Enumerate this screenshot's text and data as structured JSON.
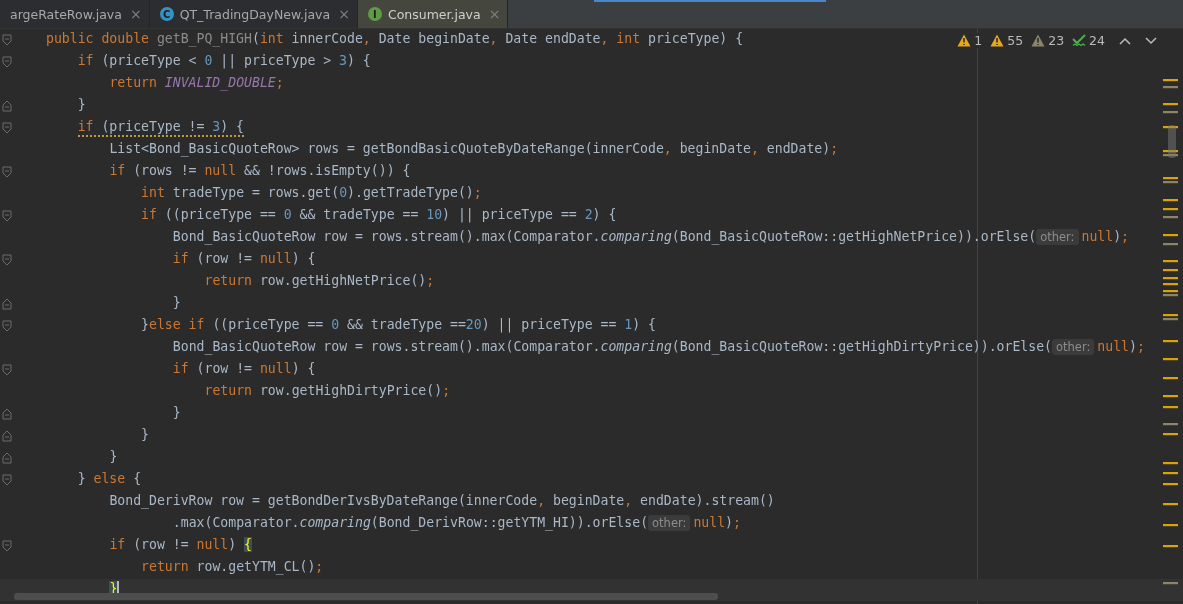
{
  "tabs": [
    {
      "label": "argeRateRow.java",
      "close": "×",
      "selected": false
    },
    {
      "label": "QT_TradingDayNew.java",
      "badge": {
        "letter": "C",
        "color": "#3592c4"
      },
      "close": "×",
      "selected": false
    },
    {
      "label": "Consumer.java",
      "badge": {
        "letter": "I",
        "color": "#5f9b45"
      },
      "close": "×",
      "selected": true
    }
  ],
  "inspections": [
    {
      "kind": "warning",
      "count": "1"
    },
    {
      "kind": "warning",
      "count": "55"
    },
    {
      "kind": "weak",
      "count": "23"
    },
    {
      "kind": "typo",
      "count": "24"
    }
  ],
  "lines": [
    {
      "kind": "open",
      "warning": false,
      "current": false,
      "tokens": [
        {
          "text": "public double ",
          "kind": "keyword"
        },
        {
          "text": "getB_PQ_HIGH",
          "kind": "unused"
        },
        {
          "text": "(",
          "kind": "plain"
        },
        {
          "text": "int ",
          "kind": "keyword"
        },
        {
          "text": "innerCode",
          "kind": "plain"
        },
        {
          "text": ", ",
          "kind": "punct"
        },
        {
          "text": "Date beginDate",
          "kind": "plain"
        },
        {
          "text": ", ",
          "kind": "punct"
        },
        {
          "text": "Date endDate",
          "kind": "plain"
        },
        {
          "text": ", ",
          "kind": "punct"
        },
        {
          "text": "int ",
          "kind": "keyword"
        },
        {
          "text": "priceType) {",
          "kind": "plain"
        }
      ],
      "children": [
        {
          "kind": "open",
          "warning": false,
          "current": false,
          "tokens": [
            {
              "text": "if ",
              "kind": "keyword"
            },
            {
              "text": "(priceType < ",
              "kind": "plain"
            },
            {
              "text": "0",
              "kind": "number"
            },
            {
              "text": " || priceType > ",
              "kind": "plain"
            },
            {
              "text": "3",
              "kind": "number"
            },
            {
              "text": ") {",
              "kind": "plain"
            }
          ],
          "children": [
            {
              "kind": "plain",
              "warning": false,
              "current": false,
              "tokens": [
                {
                  "text": "return ",
                  "kind": "keyword"
                },
                {
                  "text": "INVALID_DOUBLE",
                  "kind": "constant"
                },
                {
                  "text": ";",
                  "kind": "punct"
                }
              ]
            }
          ]
        },
        {
          "kind": "close",
          "warning": false,
          "current": false,
          "tokens": [
            {
              "text": "}",
              "kind": "plain"
            }
          ]
        },
        {
          "kind": "open",
          "warning": true,
          "current": false,
          "tokens": [
            {
              "text": "if",
              "kind": "keyword"
            },
            {
              "text": " (priceType != ",
              "kind": "plain"
            },
            {
              "text": "3",
              "kind": "number"
            },
            {
              "text": ") {",
              "kind": "plain"
            }
          ],
          "children": [
            {
              "kind": "plain",
              "warning": false,
              "current": false,
              "tokens": [
                {
                  "text": "List<Bond_BasicQuoteRow> rows = getBondBasicQuoteByDateRange(innerCode",
                  "kind": "plain"
                },
                {
                  "text": ", ",
                  "kind": "punct"
                },
                {
                  "text": "beginDate",
                  "kind": "plain"
                },
                {
                  "text": ", ",
                  "kind": "punct"
                },
                {
                  "text": "endDate)",
                  "kind": "plain"
                },
                {
                  "text": ";",
                  "kind": "punct"
                }
              ]
            },
            {
              "kind": "open",
              "warning": false,
              "current": false,
              "tokens": [
                {
                  "text": "if ",
                  "kind": "keyword"
                },
                {
                  "text": "(rows != ",
                  "kind": "plain"
                },
                {
                  "text": "null ",
                  "kind": "keyword"
                },
                {
                  "text": "&& !rows.isEmpty()) {",
                  "kind": "plain"
                }
              ],
              "children": [
                {
                  "kind": "plain",
                  "warning": false,
                  "current": false,
                  "tokens": [
                    {
                      "text": "int ",
                      "kind": "keyword"
                    },
                    {
                      "text": "tradeType = rows.get(",
                      "kind": "plain"
                    },
                    {
                      "text": "0",
                      "kind": "number"
                    },
                    {
                      "text": ").getTradeType()",
                      "kind": "plain"
                    },
                    {
                      "text": ";",
                      "kind": "punct"
                    }
                  ]
                },
                {
                  "kind": "open",
                  "warning": false,
                  "current": false,
                  "tokens": [
                    {
                      "text": "if ",
                      "kind": "keyword"
                    },
                    {
                      "text": "((priceType == ",
                      "kind": "plain"
                    },
                    {
                      "text": "0",
                      "kind": "number"
                    },
                    {
                      "text": " && tradeType == ",
                      "kind": "plain"
                    },
                    {
                      "text": "10",
                      "kind": "number"
                    },
                    {
                      "text": ") || priceType == ",
                      "kind": "plain"
                    },
                    {
                      "text": "2",
                      "kind": "number"
                    },
                    {
                      "text": ") {",
                      "kind": "plain"
                    }
                  ],
                  "children": [
                    {
                      "kind": "plain",
                      "warning": false,
                      "current": false,
                      "tokens": [
                        {
                          "text": "Bond_BasicQuoteRow row = rows.stream().max(Comparator.",
                          "kind": "plain"
                        },
                        {
                          "text": "comparing",
                          "kind": "italic"
                        },
                        {
                          "text": "(Bond_BasicQuoteRow::getHighNetPrice)).orElse(",
                          "kind": "plain"
                        },
                        {
                          "text": "other:",
                          "kind": "hint"
                        },
                        {
                          "text": "null",
                          "kind": "keyword"
                        },
                        {
                          "text": ")",
                          "kind": "plain"
                        },
                        {
                          "text": ";",
                          "kind": "punct"
                        }
                      ]
                    },
                    {
                      "kind": "open",
                      "warning": false,
                      "current": false,
                      "tokens": [
                        {
                          "text": "if ",
                          "kind": "keyword"
                        },
                        {
                          "text": "(row != ",
                          "kind": "plain"
                        },
                        {
                          "text": "null",
                          "kind": "keyword"
                        },
                        {
                          "text": ") {",
                          "kind": "plain"
                        }
                      ],
                      "children": [
                        {
                          "kind": "plain",
                          "warning": false,
                          "current": false,
                          "tokens": [
                            {
                              "text": "return ",
                              "kind": "keyword"
                            },
                            {
                              "text": "row.getHighNetPrice()",
                              "kind": "plain"
                            },
                            {
                              "text": ";",
                              "kind": "punct"
                            }
                          ]
                        }
                      ]
                    },
                    {
                      "kind": "close",
                      "warning": false,
                      "current": false,
                      "tokens": [
                        {
                          "text": "}",
                          "kind": "plain"
                        }
                      ]
                    }
                  ]
                },
                {
                  "kind": "open",
                  "warning": false,
                  "current": false,
                  "tokens": [
                    {
                      "text": "}",
                      "kind": "plain"
                    },
                    {
                      "text": "else if ",
                      "kind": "keyword"
                    },
                    {
                      "text": "((priceType == ",
                      "kind": "plain"
                    },
                    {
                      "text": "0",
                      "kind": "number"
                    },
                    {
                      "text": " && tradeType ==",
                      "kind": "plain"
                    },
                    {
                      "text": "20",
                      "kind": "number"
                    },
                    {
                      "text": ") || priceType == ",
                      "kind": "plain"
                    },
                    {
                      "text": "1",
                      "kind": "number"
                    },
                    {
                      "text": ") {",
                      "kind": "plain"
                    }
                  ],
                  "children": [
                    {
                      "kind": "plain",
                      "warning": false,
                      "current": false,
                      "tokens": [
                        {
                          "text": "Bond_BasicQuoteRow row = rows.stream().max(Comparator.",
                          "kind": "plain"
                        },
                        {
                          "text": "comparing",
                          "kind": "italic"
                        },
                        {
                          "text": "(Bond_BasicQuoteRow::getHighDirtyPrice)).orElse(",
                          "kind": "plain"
                        },
                        {
                          "text": "other:",
                          "kind": "hint"
                        },
                        {
                          "text": "null",
                          "kind": "keyword"
                        },
                        {
                          "text": ")",
                          "kind": "plain"
                        },
                        {
                          "text": ";",
                          "kind": "punct"
                        }
                      ]
                    },
                    {
                      "kind": "open",
                      "warning": false,
                      "current": false,
                      "tokens": [
                        {
                          "text": "if ",
                          "kind": "keyword"
                        },
                        {
                          "text": "(row != ",
                          "kind": "plain"
                        },
                        {
                          "text": "null",
                          "kind": "keyword"
                        },
                        {
                          "text": ") {",
                          "kind": "plain"
                        }
                      ],
                      "children": [
                        {
                          "kind": "plain",
                          "warning": false,
                          "current": false,
                          "tokens": [
                            {
                              "text": "return ",
                              "kind": "keyword"
                            },
                            {
                              "text": "row.getHighDirtyPrice()",
                              "kind": "plain"
                            },
                            {
                              "text": ";",
                              "kind": "punct"
                            }
                          ]
                        }
                      ]
                    },
                    {
                      "kind": "close",
                      "warning": false,
                      "current": false,
                      "tokens": [
                        {
                          "text": "}",
                          "kind": "plain"
                        }
                      ]
                    }
                  ]
                },
                {
                  "kind": "close",
                  "warning": false,
                  "current": false,
                  "tokens": [
                    {
                      "text": "}",
                      "kind": "plain"
                    }
                  ]
                }
              ]
            },
            {
              "kind": "close",
              "warning": false,
              "current": false,
              "tokens": [
                {
                  "text": "}",
                  "kind": "plain"
                }
              ]
            }
          ]
        },
        {
          "kind": "open",
          "warning": false,
          "current": false,
          "tokens": [
            {
              "text": "} ",
              "kind": "plain"
            },
            {
              "text": "else ",
              "kind": "keyword"
            },
            {
              "text": "{",
              "kind": "plain"
            }
          ],
          "children": [
            {
              "kind": "plain",
              "warning": false,
              "current": false,
              "tokens": [
                {
                  "text": "Bond_DerivRow row = getBondDerIvsByDateRange(innerCode",
                  "kind": "plain"
                },
                {
                  "text": ", ",
                  "kind": "punct"
                },
                {
                  "text": "beginDate",
                  "kind": "plain"
                },
                {
                  "text": ", ",
                  "kind": "punct"
                },
                {
                  "text": "endDate).stream()",
                  "kind": "plain"
                }
              ],
              "children": [
                {
                  "kind": "continuation",
                  "warning": false,
                  "current": false,
                  "tokens": [
                    {
                      "text": ".max(Comparator.",
                      "kind": "plain"
                    },
                    {
                      "text": "comparing",
                      "kind": "italic"
                    },
                    {
                      "text": "(Bond_DerivRow::getYTM_HI)).orElse(",
                      "kind": "plain"
                    },
                    {
                      "text": "other:",
                      "kind": "hint"
                    },
                    {
                      "text": "null",
                      "kind": "keyword"
                    },
                    {
                      "text": ")",
                      "kind": "plain"
                    },
                    {
                      "text": ";",
                      "kind": "punct"
                    }
                  ]
                }
              ]
            },
            {
              "kind": "open",
              "warning": false,
              "current": false,
              "tokens": [
                {
                  "text": "if ",
                  "kind": "keyword"
                },
                {
                  "text": "(row != ",
                  "kind": "plain"
                },
                {
                  "text": "null",
                  "kind": "keyword"
                },
                {
                  "text": ") ",
                  "kind": "plain"
                },
                {
                  "text": "{",
                  "kind": "match"
                }
              ],
              "children": [
                {
                  "kind": "plain",
                  "warning": false,
                  "current": false,
                  "tokens": [
                    {
                      "text": "return ",
                      "kind": "keyword"
                    },
                    {
                      "text": "row.getYTM_CL()",
                      "kind": "plain"
                    },
                    {
                      "text": ";",
                      "kind": "punct"
                    }
                  ]
                }
              ]
            },
            {
              "kind": "plain",
              "warning": false,
              "current": true,
              "tokens": [
                {
                  "text": "}",
                  "kind": "match"
                }
              ]
            }
          ]
        }
      ]
    }
  ]
}
